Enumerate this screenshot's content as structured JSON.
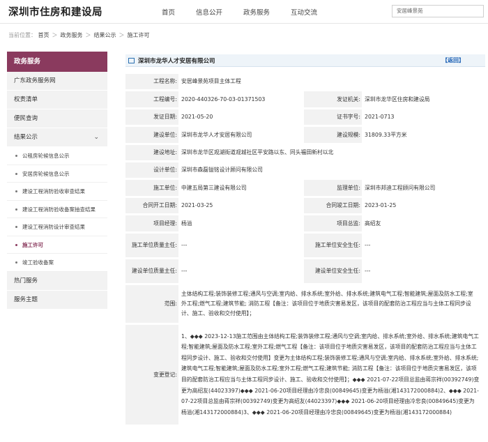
{
  "header": {
    "logo": "深圳市住房和建设局",
    "nav": [
      "首页",
      "信息公开",
      "政务服务",
      "互动交流"
    ],
    "search_value": "安居峰景苑"
  },
  "breadcrumb": {
    "prefix": "当前位置：",
    "items": [
      "首页",
      "政务服务",
      "结果公示",
      "施工许可"
    ],
    "sep": "＞"
  },
  "sidebar": {
    "title": "政务服务",
    "items_top": [
      "广东政务服务网",
      "权责清单",
      "便民查询"
    ],
    "section": "结果公示",
    "section_chevron": "⌄",
    "subitems": [
      "公租房轮候信息公示",
      "安居房轮候信息公示",
      "建设工程消防验收审查结果",
      "建设工程消防验收备案抽查结果",
      "建设工程消防设计审查结果",
      "施工许可",
      "竣工验收备案"
    ],
    "active_index": 5,
    "items_bottom": [
      "热门服务",
      "服务主题"
    ]
  },
  "content": {
    "company": "深圳市龙华人才安居有限公司",
    "back_label": "【返回】",
    "rows": [
      {
        "l1": "工程名称:",
        "v1": "安居峰景苑项目主体工程"
      },
      {
        "l1": "工程编号:",
        "v1": "2020-440326-70-03-01371503",
        "l2": "发证机关:",
        "v2": "深圳市龙华区住房和建设局"
      },
      {
        "l1": "发证日期:",
        "v1": "2021-05-20",
        "l2": "证书字号:",
        "v2": "2021-0713"
      },
      {
        "l1": "建设单位:",
        "v1": "深圳市龙华人才安居有限公司",
        "l2": "建设规模:",
        "v2": "31809.33平方米"
      },
      {
        "l1": "建设地址:",
        "v1": "深圳市龙华区观湖街道观城社区平安路以东、同头福田新村以北"
      },
      {
        "l1": "设计单位:",
        "v1": "深圳市森磊镒铭设计顾问有限公司"
      },
      {
        "l1": "施工单位:",
        "v1": "中建五局第三建设有限公司",
        "l2": "监理单位:",
        "v2": "深圳市邦迪工程顾问有限公司"
      },
      {
        "l1": "合同开工日期:",
        "v1": "2021-03-25",
        "l2": "合同竣工日期:",
        "v2": "2023-01-25"
      },
      {
        "l1": "项目经理:",
        "v1": "杨溢",
        "l2": "项目总监:",
        "v2": "高绍友"
      },
      {
        "l1": "施工单位质量主任:",
        "v1": "---",
        "l2": "施工单位安全生任:",
        "v2": "---"
      },
      {
        "l1": "建设单位质量主任:",
        "v1": "---",
        "l2": "建设单位安全生任:",
        "v2": "---"
      }
    ],
    "scope_label": "范围:",
    "scope": "主体结构工程;装饰装修工程;通风与空调;室内给、排水系统;室外给、排水系统;建筑电气工程;智能建筑;屋面及防水工程;室外工程;燃气工程;建筑节能; 消防工程【备注：该项目位于地质灾害易发区，该项目的配套防治工程应当与主体工程同步设计、施工、验收和交付使用】；",
    "change_label": "变更登记:",
    "change": "1、◆◆◆ 2023-12-13施工范围由主体结构工程;装饰装修工程;通风与空调;室内给、排水系统;室外给、排水系统;建筑电气工程;智能建筑;屋面及防水工程;室外工程;燃气工程【备注：该项目位于地质灾害易发区，该项目的配套防治工程应当与主体工程同步设计、施工、验收和交付使用】变更为主体结构工程;装饰装修工程;通风与空调;室内给、排水系统;室外给、排水系统;建筑电气工程;智能建筑;屋面及防水工程;室外工程;燃气工程;建筑节能; 消防工程【备注：该项目位于地质灾害易发区，该项目的配套防治工程应当与主体工程同步设计、施工、验收和交付使用】；◆◆◆ 2021-07-22项目总监由蒋宗祥(00392749)变更为高绍友(44023397)◆◆◆ 2021-06-20项目经理由冷忠良(00849645)变更为杨溢(湘143172000884)2、◆◆◆ 2021-07-22项目总监由蒋宗祥(00392749)变更为高绍友(44023397)◆◆◆ 2021-06-20项目经理由冷忠良(00849645)变更为杨溢(湘143172000884)3、◆◆◆ 2021-06-20项目经理由冷忠良(00849645)变更为杨溢(湘143172000884)"
  }
}
